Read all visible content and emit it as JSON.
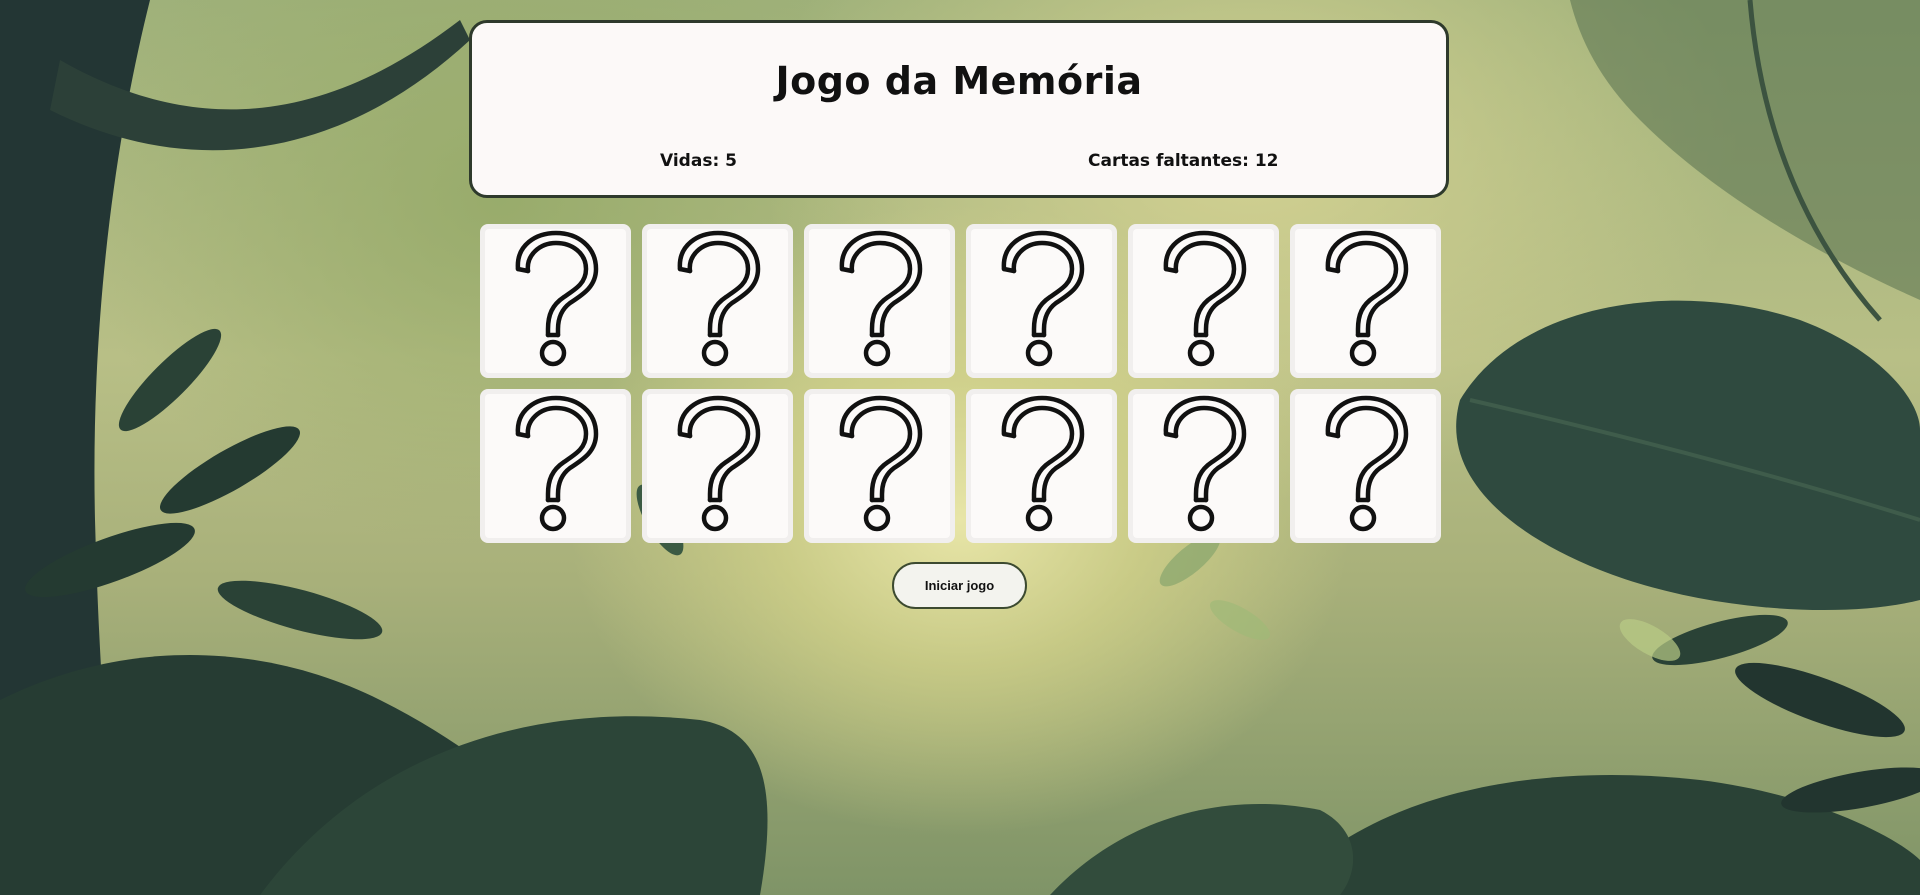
{
  "header": {
    "title": "Jogo da Memória",
    "lives_label": "Vidas: 5",
    "remaining_label": "Cartas faltantes: 12"
  },
  "board": {
    "card_count": 12,
    "card_back_icon": "question-mark-icon"
  },
  "controls": {
    "start_label": "Iniciar jogo"
  },
  "colors": {
    "panel_bg": "#fcf9f8",
    "panel_border": "#2e3a2c",
    "card_bg": "#fcfaf9",
    "button_bg": "#f3f3ee"
  }
}
